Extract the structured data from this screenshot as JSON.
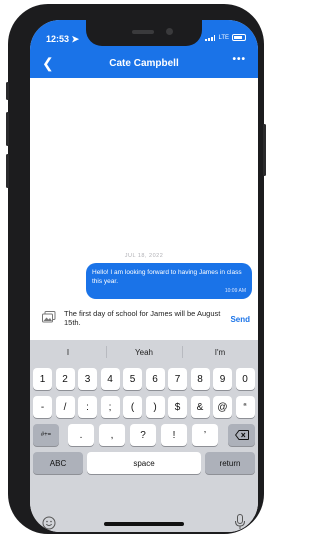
{
  "status_bar": {
    "time": "12:53",
    "network": "LTE"
  },
  "header": {
    "title": "Cate Campbell",
    "more": "•••"
  },
  "conversation": {
    "date": "JUL 18, 2022",
    "message": {
      "text": "Hello! I am looking forward to having James in class this year.",
      "time": "10:09 AM"
    }
  },
  "composer": {
    "text": "The first day of school for James will be August 15th.",
    "send_label": "Send"
  },
  "keyboard": {
    "suggestions": [
      "I",
      "Yeah",
      "I'm"
    ],
    "row1": [
      "1",
      "2",
      "3",
      "4",
      "5",
      "6",
      "7",
      "8",
      "9",
      "0"
    ],
    "row2": [
      "-",
      "/",
      ":",
      ";",
      "(",
      ")",
      "$",
      "&",
      "@",
      "“"
    ],
    "row3_switch": "#+=",
    "row3": [
      ".",
      ",",
      "?",
      "!",
      "’"
    ],
    "abc": "ABC",
    "space": "space",
    "return": "return"
  },
  "colors": {
    "accent": "#1a73e8",
    "keyboard_bg": "#d2d4d9"
  }
}
